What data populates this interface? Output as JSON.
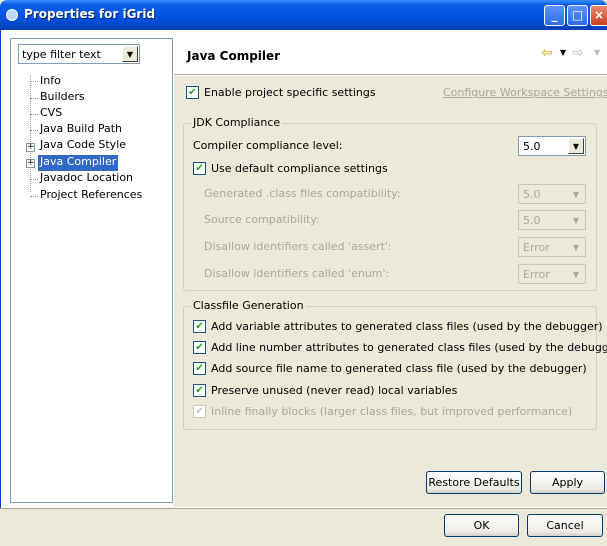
{
  "window": {
    "title": "Properties for iGrid"
  },
  "filter": {
    "value": "type filter text"
  },
  "tree": {
    "items": [
      {
        "label": "Info"
      },
      {
        "label": "Builders"
      },
      {
        "label": "CVS"
      },
      {
        "label": "Java Build Path"
      },
      {
        "label": "Java Code Style",
        "expander": "+"
      },
      {
        "label": "Java Compiler",
        "expander": "+",
        "selected": true
      },
      {
        "label": "Javadoc Location"
      },
      {
        "label": "Project References"
      }
    ]
  },
  "header": {
    "title": "Java Compiler"
  },
  "enable_project": {
    "label": "Enable project specific settings",
    "checked": true
  },
  "configure_link": "Configure Workspace Settings...",
  "jdk": {
    "group_title": "JDK Compliance",
    "compliance_label": "Compiler compliance level:",
    "compliance_value": "5.0",
    "use_default_label": "Use default compliance settings",
    "generated_label": "Generated .class files compatibility:",
    "generated_value": "5.0",
    "source_label": "Source compatibility:",
    "source_value": "5.0",
    "assert_label": "Disallow identifiers called 'assert':",
    "assert_value": "Error",
    "enum_label": "Disallow identifiers called 'enum':",
    "enum_value": "Error"
  },
  "classfile": {
    "group_title": "Classfile Generation",
    "options": [
      "Add variable attributes to generated class files (used by the debugger)",
      "Add line number attributes to generated class files (used by the debugger)",
      "Add source file name to generated class file (used by the debugger)",
      "Preserve unused (never read) local variables",
      "Inline finally blocks (larger class files, but improved performance)"
    ]
  },
  "buttons": {
    "restore": "Restore Defaults",
    "apply": "Apply",
    "ok": "OK",
    "cancel": "Cancel"
  },
  "colors": {
    "titlebar": "#0054E3",
    "selection": "#316AC5",
    "dialog_bg": "#ECE9D8"
  }
}
